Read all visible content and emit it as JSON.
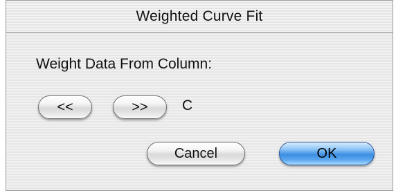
{
  "dialog": {
    "title": "Weighted Curve Fit",
    "prompt_label": "Weight Data From Column:",
    "prev_button_label": "<<",
    "next_button_label": ">>",
    "selected_column": "C",
    "cancel_button_label": "Cancel",
    "ok_button_label": "OK"
  },
  "colors": {
    "default_button_accent": "#3d8ee3",
    "background_stripe_light": "#f1f1f1",
    "background_stripe_dark": "#e6e6e6"
  }
}
